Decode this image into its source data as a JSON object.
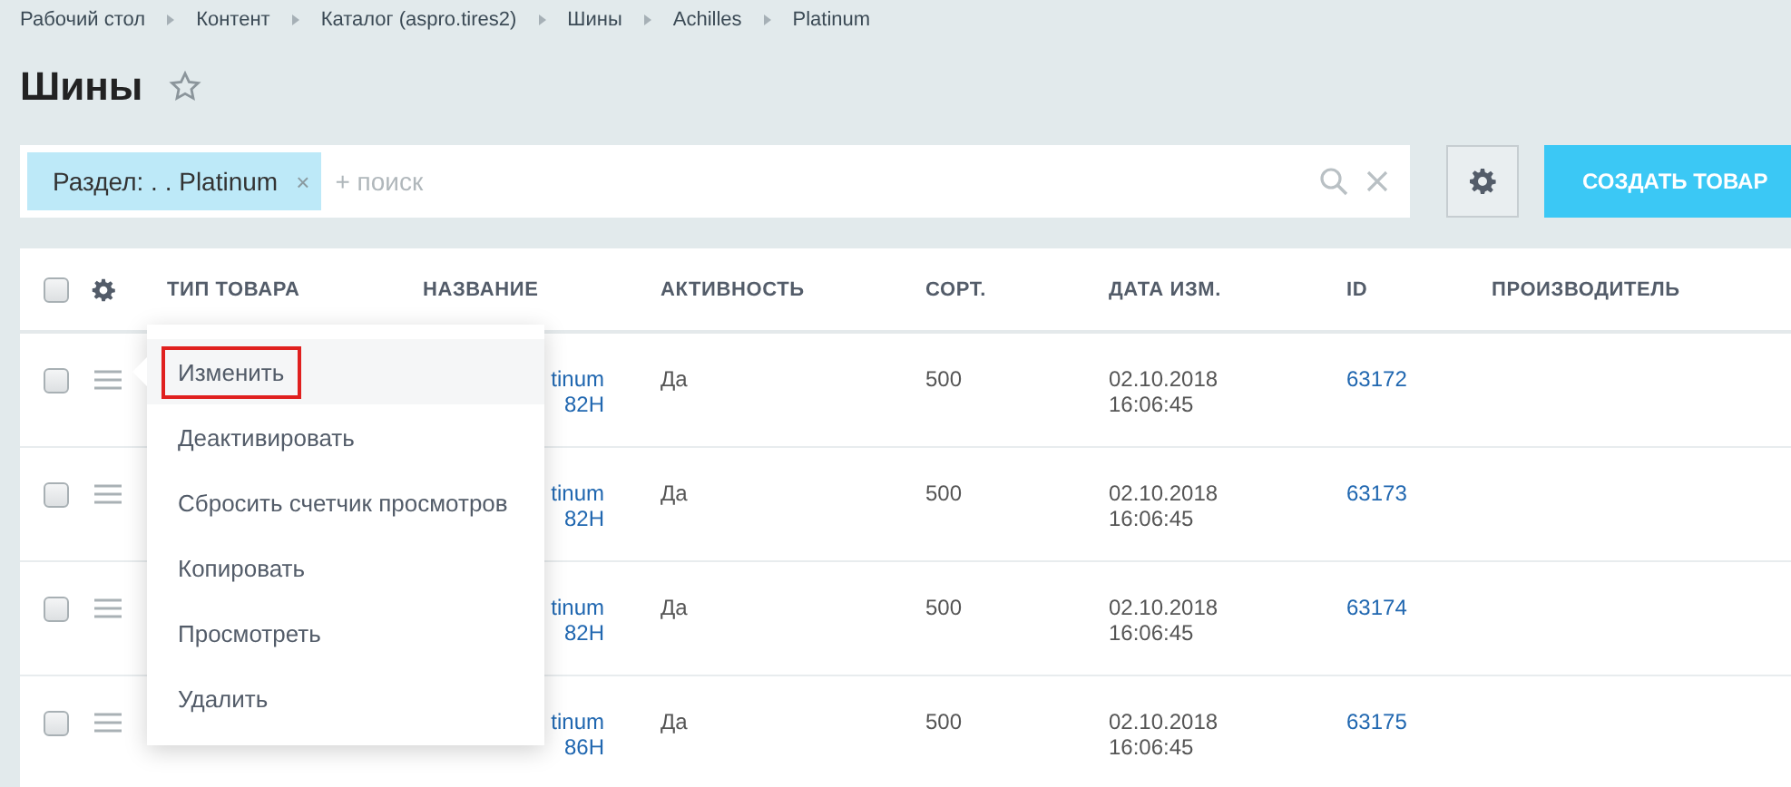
{
  "breadcrumbs": [
    "Рабочий стол",
    "Контент",
    "Каталог (aspro.tires2)",
    "Шины",
    "Achilles",
    "Platinum"
  ],
  "page_title": "Шины",
  "filter": {
    "tag": "Раздел: . . Platinum",
    "remove": "×",
    "placeholder": "+ поиск"
  },
  "create_button": "СОЗДАТЬ ТОВАР",
  "table": {
    "header_checked": false,
    "columns": [
      "ТИП ТОВАРА",
      "НАЗВАНИЕ",
      "АКТИВНОСТЬ",
      "СОРТ.",
      "ДАТА ИЗМ.",
      "ID",
      "ПРОИЗВОДИТЕЛЬ"
    ],
    "rows": [
      {
        "checked": false,
        "name": [
          "tinum",
          "82H"
        ],
        "active": "Да",
        "sort": "500",
        "date": "02.10.2018",
        "time": "16:06:45",
        "id": "63172"
      },
      {
        "checked": false,
        "name": [
          "tinum",
          "82H"
        ],
        "active": "Да",
        "sort": "500",
        "date": "02.10.2018",
        "time": "16:06:45",
        "id": "63173"
      },
      {
        "checked": false,
        "name": [
          "tinum",
          "82H"
        ],
        "active": "Да",
        "sort": "500",
        "date": "02.10.2018",
        "time": "16:06:45",
        "id": "63174"
      },
      {
        "checked": false,
        "name": [
          "tinum",
          "86H"
        ],
        "active": "Да",
        "sort": "500",
        "date": "02.10.2018",
        "time": "16:06:45",
        "id": "63175"
      }
    ]
  },
  "context_menu": {
    "items": [
      {
        "label": "Изменить",
        "selected": true
      },
      {
        "label": "Деактивировать",
        "selected": false
      },
      {
        "label": "Сбросить счетчик просмотров",
        "selected": false
      },
      {
        "label": "Копировать",
        "selected": false
      },
      {
        "label": "Просмотреть",
        "selected": false
      },
      {
        "label": "Удалить",
        "selected": false
      }
    ]
  }
}
